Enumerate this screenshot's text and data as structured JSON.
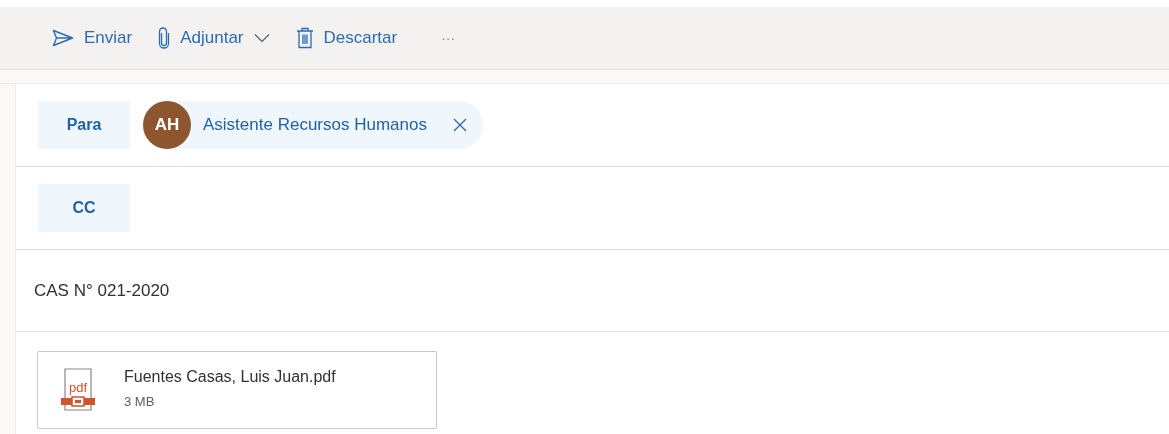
{
  "toolbar": [
    {
      "kind": "send",
      "label": "Enviar",
      "dropdown": false
    },
    {
      "kind": "attach",
      "label": "Adjuntar",
      "dropdown": true
    },
    {
      "kind": "discard",
      "label": "Descartar",
      "dropdown": false
    },
    {
      "kind": "more",
      "label": "···"
    }
  ],
  "to": {
    "label": "Para",
    "recipients": [
      {
        "initials": "AH",
        "name": "Asistente Recursos Humanos",
        "color": "#8e562e"
      }
    ]
  },
  "cc": {
    "label": "CC"
  },
  "subject": {
    "value": "CAS N° 021-2020"
  },
  "attachments": [
    {
      "name": "Fuentes Casas, Luis Juan.pdf",
      "size": "3 MB",
      "type": "pdf"
    }
  ]
}
